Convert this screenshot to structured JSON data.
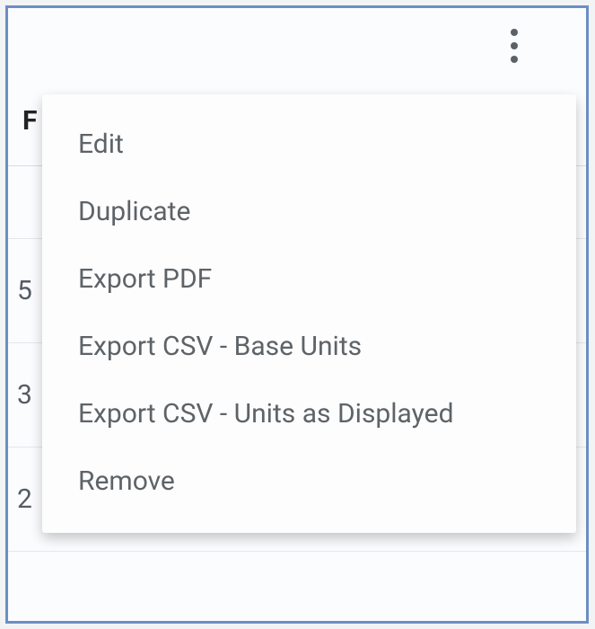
{
  "kebab": {
    "semantic": "more-options"
  },
  "background_table": {
    "header_fragment": "F",
    "cells": [
      "",
      "5",
      "3",
      "2"
    ]
  },
  "menu": {
    "items": [
      {
        "name": "menu-item-edit",
        "label": "Edit"
      },
      {
        "name": "menu-item-duplicate",
        "label": "Duplicate"
      },
      {
        "name": "menu-item-export-pdf",
        "label": "Export PDF"
      },
      {
        "name": "menu-item-export-csv-base",
        "label": "Export CSV - Base Units"
      },
      {
        "name": "menu-item-export-csv-displayed",
        "label": "Export CSV - Units as Displayed"
      },
      {
        "name": "menu-item-remove",
        "label": "Remove"
      }
    ]
  }
}
